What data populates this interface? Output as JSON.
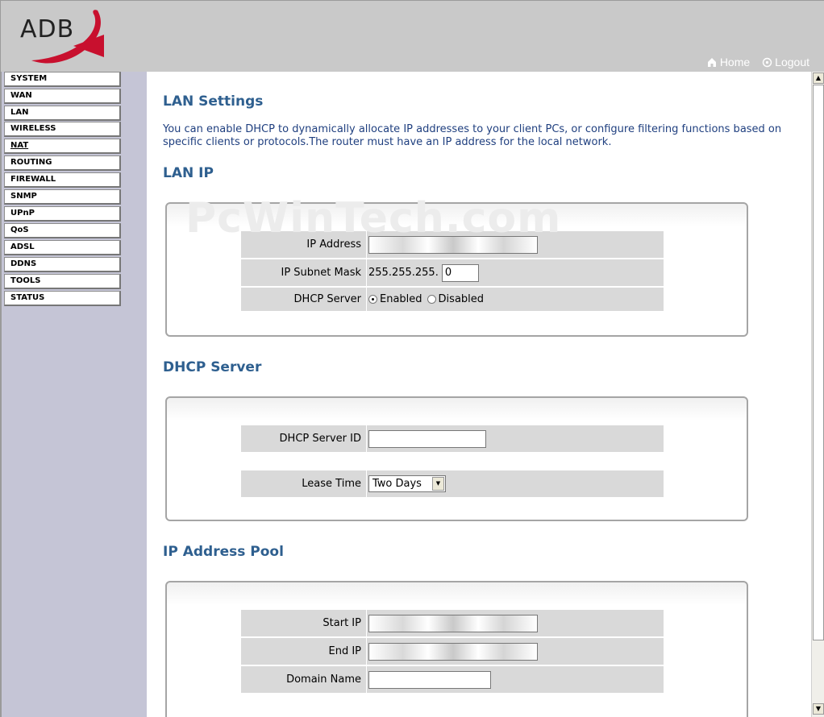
{
  "header": {
    "logo_text": "ADB",
    "home_label": "Home",
    "logout_label": "Logout"
  },
  "sidebar": {
    "items": [
      {
        "label": "SYSTEM"
      },
      {
        "label": "WAN"
      },
      {
        "label": "LAN"
      },
      {
        "label": "WIRELESS"
      },
      {
        "label": "NAT"
      },
      {
        "label": "ROUTING"
      },
      {
        "label": "FIREWALL"
      },
      {
        "label": "SNMP"
      },
      {
        "label": "UPnP"
      },
      {
        "label": "QoS"
      },
      {
        "label": "ADSL"
      },
      {
        "label": "DDNS"
      },
      {
        "label": "TOOLS"
      },
      {
        "label": "STATUS"
      }
    ]
  },
  "main": {
    "title": "LAN Settings",
    "description": "You can enable DHCP to dynamically allocate IP addresses to your client PCs, or configure filtering functions based on specific clients or protocols.The router must have an IP address for the local network.",
    "watermark": "PcWinTech.com",
    "lan_ip": {
      "title": "LAN IP",
      "ip_address_label": "IP Address",
      "subnet_label": "IP Subnet Mask",
      "subnet_prefix": "255.255.255.",
      "subnet_value": "0",
      "dhcp_label": "DHCP Server",
      "enabled_label": "Enabled",
      "disabled_label": "Disabled"
    },
    "dhcp_server": {
      "title": "DHCP Server",
      "server_id_label": "DHCP Server ID",
      "server_id_value": "",
      "lease_label": "Lease Time",
      "lease_value": "Two Days"
    },
    "ip_pool": {
      "title": "IP Address Pool",
      "start_label": "Start IP",
      "end_label": "End IP",
      "domain_label": "Domain Name",
      "domain_value": ""
    }
  },
  "colors": {
    "heading": "#2e5f8f",
    "description": "#1f3f7f",
    "header_bg": "#c9c9c9",
    "sidebar_bg": "#c5c5d6",
    "logo_accent": "#c8102e"
  }
}
